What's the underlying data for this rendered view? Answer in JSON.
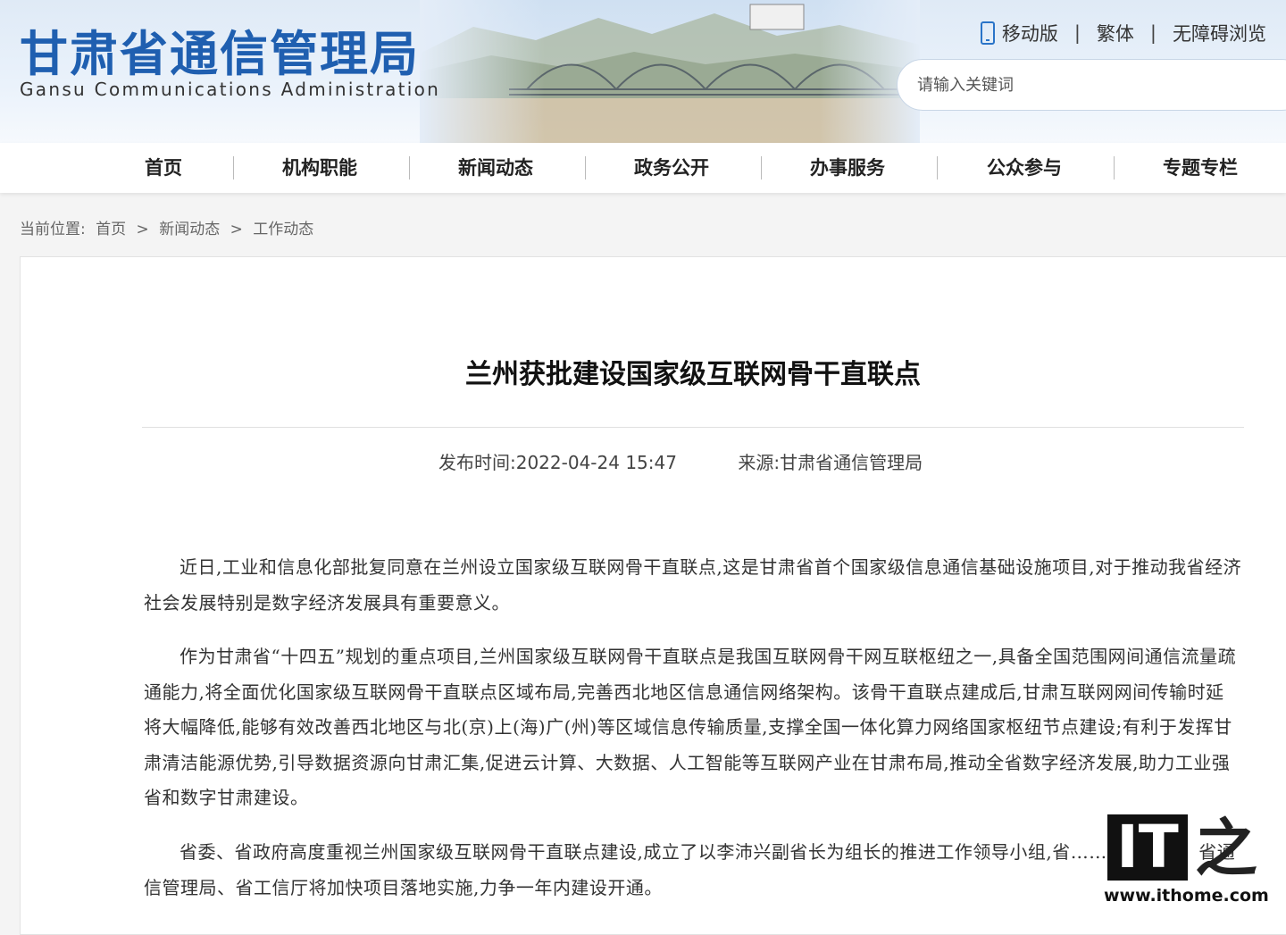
{
  "header": {
    "site_name": "甘肃省通信管理局",
    "site_name_en": "Gansu Communications Administration",
    "links": [
      "移动版",
      "繁体",
      "无障碍浏览"
    ],
    "search_placeholder": "请输入关键词"
  },
  "nav": {
    "items": [
      "首页",
      "机构职能",
      "新闻动态",
      "政务公开",
      "办事服务",
      "公众参与",
      "专题专栏"
    ]
  },
  "breadcrumb": {
    "label": "当前位置:",
    "items": [
      "首页",
      ">",
      "新闻动态",
      ">",
      "工作动态"
    ]
  },
  "article": {
    "title": "兰州获批建设国家级互联网骨干直联点",
    "publish_time": "发布时间:2022-04-24 15:47",
    "source": "来源:甘肃省通信管理局",
    "paragraphs": [
      "近日,工业和信息化部批复同意在兰州设立国家级互联网骨干直联点,这是甘肃省首个国家级信息通信基础设施项目,对于推动我省经济社会发展特别是数字经济发展具有重要意义。",
      "作为甘肃省“十四五”规划的重点项目,兰州国家级互联网骨干直联点是我国互联网骨干网互联枢纽之一,具备全国范围网间通信流量疏通能力,将全面优化国家级互联网骨干直联点区域布局,完善西北地区信息通信网络架构。该骨干直联点建成后,甘肃互联网网间传输时延将大幅降低,能够有效改善西北地区与北(京)上(海)广(州)等区域信息传输质量,支撑全国一体化算力网络国家枢纽节点建设;有利于发挥甘肃清洁能源优势,引导数据资源向甘肃汇集,促进云计算、大数据、人工智能等互联网产业在甘肃布局,推动全省数字经济发展,助力工业强省和数字甘肃建设。",
      "省委、省政府高度重视兰州国家级互联网骨干直联点建设,成立了以李沛兴副省长为组长的推进工作领导小组,省……相关工作。省通信管理局、省工信厅将加快项目落地实施,力争一年内建设开通。"
    ]
  },
  "watermark": {
    "brand": "IT",
    "char": "之",
    "url": "www.ithome.com"
  },
  "colors": {
    "brand_blue": "#1f5fb0",
    "icon_blue": "#2a74c8"
  }
}
